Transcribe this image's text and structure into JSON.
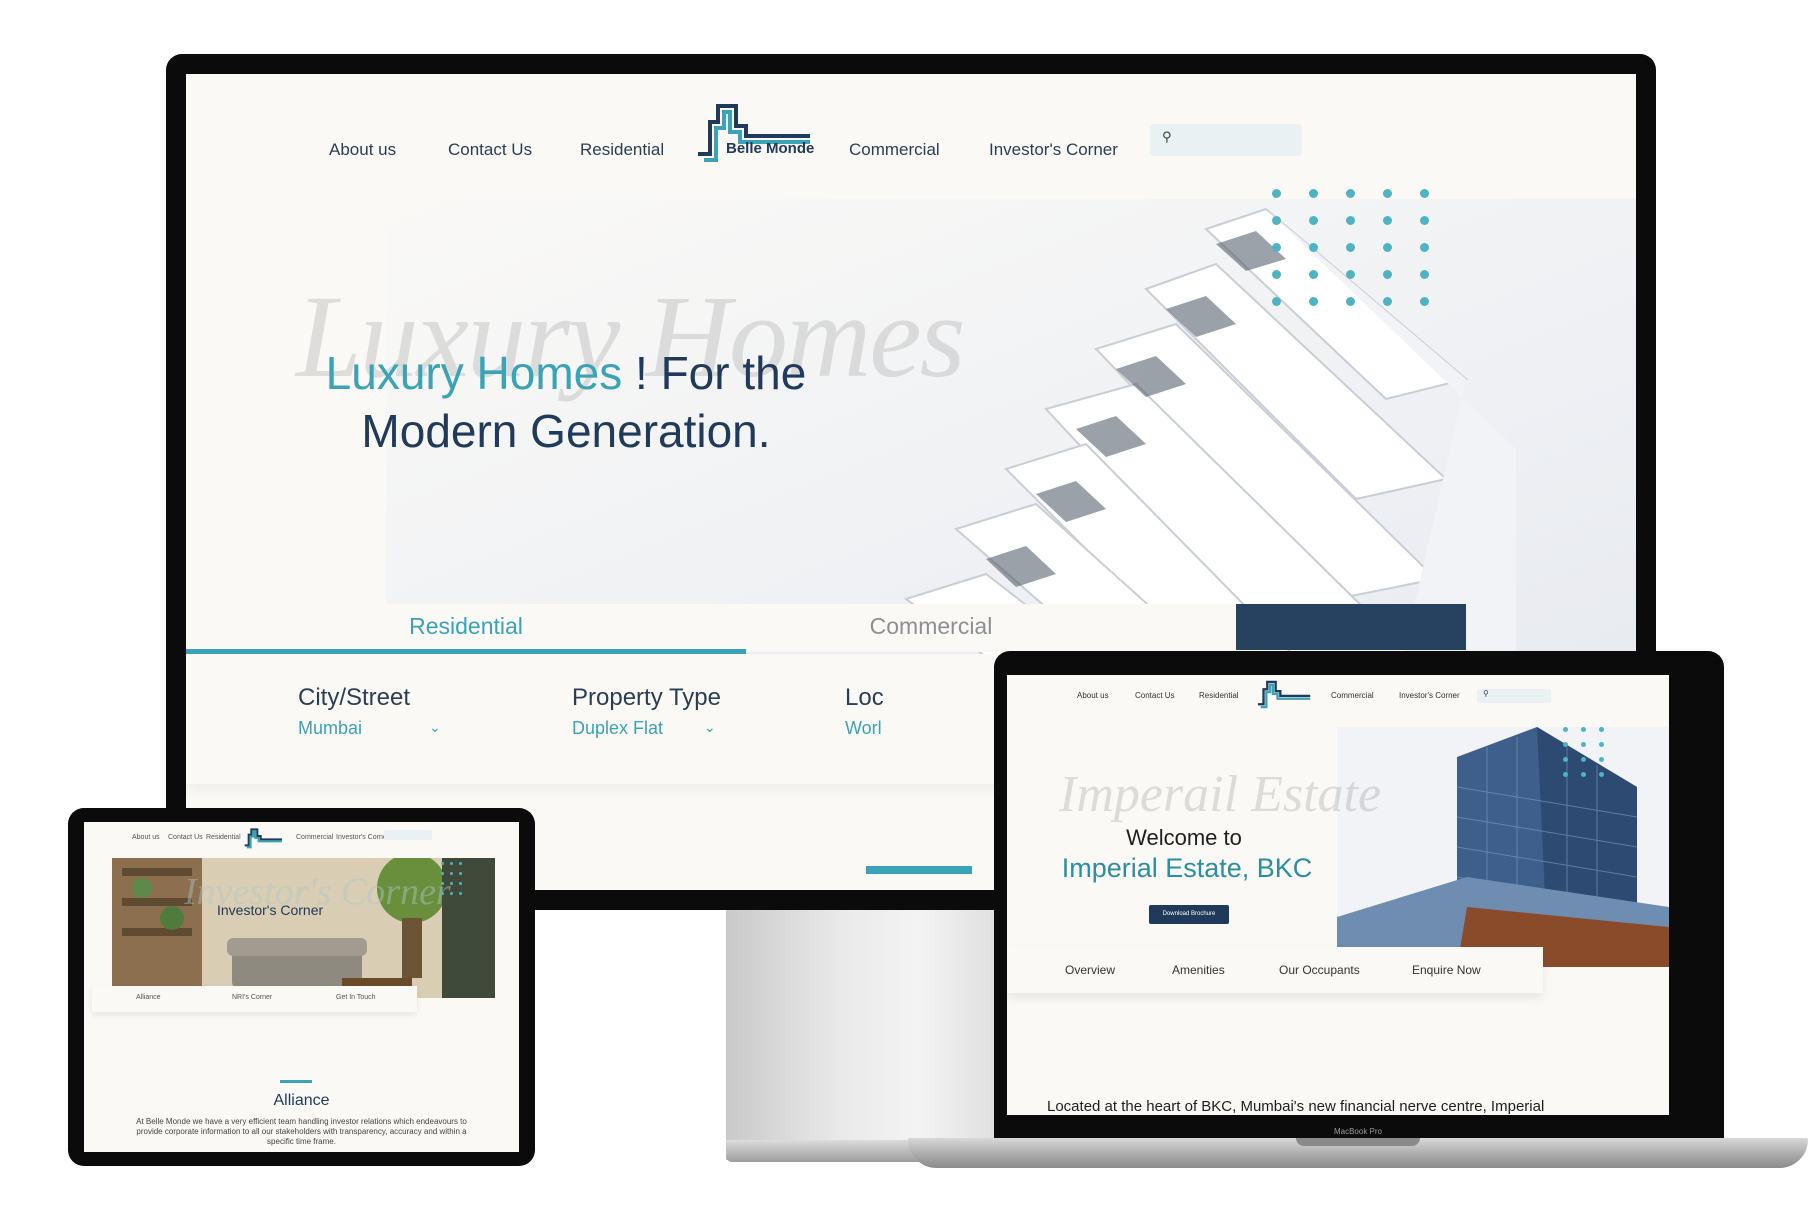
{
  "brand": {
    "name": "Belle Monde",
    "accent": "#3aa3b5",
    "navy": "#1f3a5a"
  },
  "desktop": {
    "nav": {
      "left": [
        "About us",
        "Contact Us",
        "Residential"
      ],
      "right": [
        "Commercial",
        "Investor's Corner"
      ]
    },
    "hero": {
      "script_text": "Luxury Homes",
      "title_accent": "Luxury Homes",
      "title_rest_line1": " ! For the",
      "title_line2": "Modern Generation."
    },
    "tabs": {
      "residential": "Residential",
      "commercial": "Commercial"
    },
    "filters": [
      {
        "label": "City/Street",
        "value": "Mumbai"
      },
      {
        "label": "Property Type",
        "value": "Duplex Flat"
      },
      {
        "label": "Loc",
        "value": "Worl"
      }
    ]
  },
  "tablet": {
    "nav": [
      "About us",
      "Contact Us",
      "Residential",
      "Commercial",
      "Investor's Corner"
    ],
    "hero_script": "Investor's Corner",
    "hero_title": "Investor's Corner",
    "tabs": [
      "Alliance",
      "NRI's Corner",
      "Get In Touch"
    ],
    "section_heading": "Alliance",
    "section_body": "At Belle Monde we have a very efficient team handling investor relations which endeavours to provide corporate information to all our stakeholders with transparency, accuracy and within a specific time frame."
  },
  "laptop": {
    "nav": {
      "left": [
        "About us",
        "Contact Us",
        "Residential"
      ],
      "right": [
        "Commercial",
        "Investor's Corner"
      ]
    },
    "hero_script": "Imperail Estate",
    "welcome": "Welcome to",
    "estate": "Imperial Estate, BKC",
    "button": "Download Brochure",
    "tabs": [
      "Overview",
      "Amenities",
      "Our Occupants",
      "Enquire Now"
    ],
    "paragraph": "Located at the heart of BKC, Mumbai's new financial nerve centre, Imperial",
    "model": "MacBook Pro"
  }
}
